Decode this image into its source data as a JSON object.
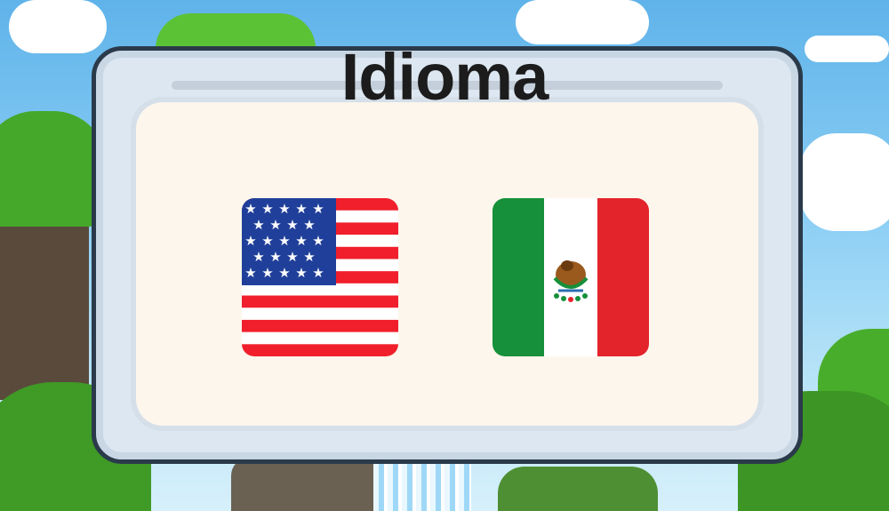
{
  "dialog": {
    "title": "Idioma"
  },
  "languages": [
    {
      "id": "en",
      "flag_icon": "usa-flag-icon"
    },
    {
      "id": "es",
      "flag_icon": "mexico-flag-icon"
    }
  ],
  "colors": {
    "title": "#1c1c1c",
    "panel_bg": "#fcf6ec",
    "frame_border": "#2b3a4a",
    "us_red": "#f01f2b",
    "us_blue": "#1f3f9a",
    "mx_green": "#16903a",
    "mx_red": "#e3242b"
  }
}
